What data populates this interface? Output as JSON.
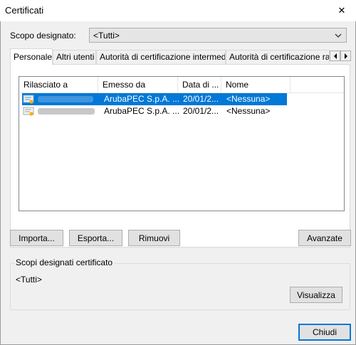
{
  "window": {
    "title": "Certificati",
    "close_glyph": "✕"
  },
  "scope": {
    "label": "Scopo designato:",
    "value": "<Tutti>"
  },
  "tabs": [
    {
      "label": "Personale"
    },
    {
      "label": "Altri utenti"
    },
    {
      "label": "Autorità di certificazione intermedie"
    },
    {
      "label": "Autorità di certificazione radice"
    }
  ],
  "table": {
    "columns": [
      "Rilasciato a",
      "Emesso da",
      "Data di ...",
      "Nome"
    ],
    "rows": [
      {
        "issued_by": "ArubaPEC S.p.A. ...",
        "date": "20/01/2...",
        "name": "<Nessuna>",
        "selected": true
      },
      {
        "issued_by": "ArubaPEC S.p.A. ...",
        "date": "20/01/2...",
        "name": "<Nessuna>",
        "selected": false
      }
    ]
  },
  "buttons": {
    "import": "Importa...",
    "export": "Esporta...",
    "remove": "Rimuovi",
    "advanced": "Avanzate",
    "view": "Visualizza",
    "close": "Chiudi"
  },
  "purposes": {
    "title": "Scopi designati certificato",
    "value": "<Tutti>"
  },
  "colors": {
    "selection": "#0078d7",
    "accent": "#0078d7"
  }
}
